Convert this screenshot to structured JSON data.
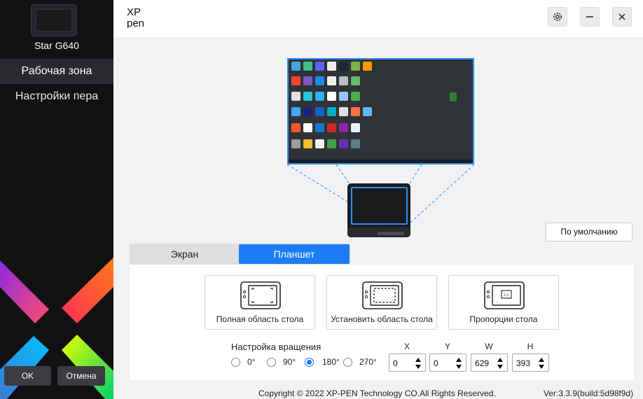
{
  "sidebar": {
    "device_name": "Star G640",
    "items": [
      {
        "label": "Рабочая зона",
        "active": true
      },
      {
        "label": "Настройки пера",
        "active": false
      }
    ],
    "ok_label": "OK",
    "cancel_label": "Отмена"
  },
  "header": {
    "brand_line1": "XP",
    "brand_line2": "pen"
  },
  "preview": {
    "default_label": "По умолчанию"
  },
  "tabs": [
    {
      "label": "Экран",
      "active": false
    },
    {
      "label": "Планшет",
      "active": true
    }
  ],
  "area_options": [
    {
      "label": "Полная область стола"
    },
    {
      "label": "Установить область стола"
    },
    {
      "label": "Пропорции стола"
    }
  ],
  "rotation": {
    "title": "Настройка вращения",
    "options": [
      "0°",
      "90°",
      "180°",
      "270°"
    ],
    "selected": "180°"
  },
  "coords": {
    "labels": [
      "X",
      "Y",
      "W",
      "H"
    ],
    "values": [
      "0",
      "0",
      "629",
      "393"
    ]
  },
  "footer": {
    "copyright": "Copyright © 2022  XP-PEN Technology CO.All Rights Reserved.",
    "version": "Ver:3.3.9(build:5d98f9d)"
  },
  "colors": {
    "accent": "#1c7cf4",
    "sidebar_bg": "#111114"
  }
}
